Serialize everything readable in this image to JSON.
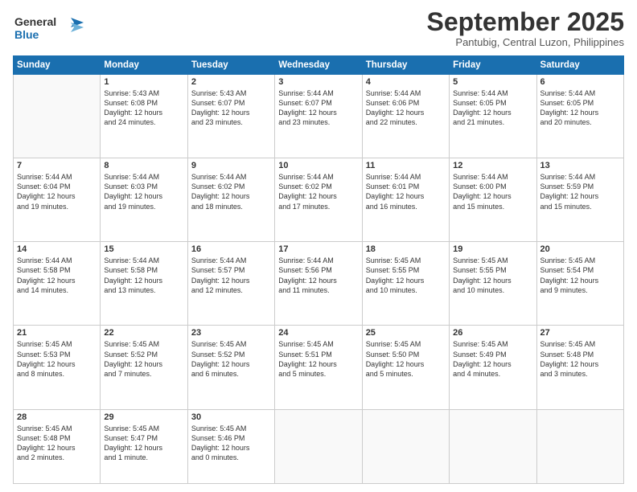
{
  "logo": {
    "line1": "General",
    "line2": "Blue"
  },
  "title": "September 2025",
  "location": "Pantubig, Central Luzon, Philippines",
  "days_header": [
    "Sunday",
    "Monday",
    "Tuesday",
    "Wednesday",
    "Thursday",
    "Friday",
    "Saturday"
  ],
  "weeks": [
    [
      {
        "day": "",
        "text": ""
      },
      {
        "day": "1",
        "text": "Sunrise: 5:43 AM\nSunset: 6:08 PM\nDaylight: 12 hours\nand 24 minutes."
      },
      {
        "day": "2",
        "text": "Sunrise: 5:43 AM\nSunset: 6:07 PM\nDaylight: 12 hours\nand 23 minutes."
      },
      {
        "day": "3",
        "text": "Sunrise: 5:44 AM\nSunset: 6:07 PM\nDaylight: 12 hours\nand 23 minutes."
      },
      {
        "day": "4",
        "text": "Sunrise: 5:44 AM\nSunset: 6:06 PM\nDaylight: 12 hours\nand 22 minutes."
      },
      {
        "day": "5",
        "text": "Sunrise: 5:44 AM\nSunset: 6:05 PM\nDaylight: 12 hours\nand 21 minutes."
      },
      {
        "day": "6",
        "text": "Sunrise: 5:44 AM\nSunset: 6:05 PM\nDaylight: 12 hours\nand 20 minutes."
      }
    ],
    [
      {
        "day": "7",
        "text": "Sunrise: 5:44 AM\nSunset: 6:04 PM\nDaylight: 12 hours\nand 19 minutes."
      },
      {
        "day": "8",
        "text": "Sunrise: 5:44 AM\nSunset: 6:03 PM\nDaylight: 12 hours\nand 19 minutes."
      },
      {
        "day": "9",
        "text": "Sunrise: 5:44 AM\nSunset: 6:02 PM\nDaylight: 12 hours\nand 18 minutes."
      },
      {
        "day": "10",
        "text": "Sunrise: 5:44 AM\nSunset: 6:02 PM\nDaylight: 12 hours\nand 17 minutes."
      },
      {
        "day": "11",
        "text": "Sunrise: 5:44 AM\nSunset: 6:01 PM\nDaylight: 12 hours\nand 16 minutes."
      },
      {
        "day": "12",
        "text": "Sunrise: 5:44 AM\nSunset: 6:00 PM\nDaylight: 12 hours\nand 15 minutes."
      },
      {
        "day": "13",
        "text": "Sunrise: 5:44 AM\nSunset: 5:59 PM\nDaylight: 12 hours\nand 15 minutes."
      }
    ],
    [
      {
        "day": "14",
        "text": "Sunrise: 5:44 AM\nSunset: 5:58 PM\nDaylight: 12 hours\nand 14 minutes."
      },
      {
        "day": "15",
        "text": "Sunrise: 5:44 AM\nSunset: 5:58 PM\nDaylight: 12 hours\nand 13 minutes."
      },
      {
        "day": "16",
        "text": "Sunrise: 5:44 AM\nSunset: 5:57 PM\nDaylight: 12 hours\nand 12 minutes."
      },
      {
        "day": "17",
        "text": "Sunrise: 5:44 AM\nSunset: 5:56 PM\nDaylight: 12 hours\nand 11 minutes."
      },
      {
        "day": "18",
        "text": "Sunrise: 5:45 AM\nSunset: 5:55 PM\nDaylight: 12 hours\nand 10 minutes."
      },
      {
        "day": "19",
        "text": "Sunrise: 5:45 AM\nSunset: 5:55 PM\nDaylight: 12 hours\nand 10 minutes."
      },
      {
        "day": "20",
        "text": "Sunrise: 5:45 AM\nSunset: 5:54 PM\nDaylight: 12 hours\nand 9 minutes."
      }
    ],
    [
      {
        "day": "21",
        "text": "Sunrise: 5:45 AM\nSunset: 5:53 PM\nDaylight: 12 hours\nand 8 minutes."
      },
      {
        "day": "22",
        "text": "Sunrise: 5:45 AM\nSunset: 5:52 PM\nDaylight: 12 hours\nand 7 minutes."
      },
      {
        "day": "23",
        "text": "Sunrise: 5:45 AM\nSunset: 5:52 PM\nDaylight: 12 hours\nand 6 minutes."
      },
      {
        "day": "24",
        "text": "Sunrise: 5:45 AM\nSunset: 5:51 PM\nDaylight: 12 hours\nand 5 minutes."
      },
      {
        "day": "25",
        "text": "Sunrise: 5:45 AM\nSunset: 5:50 PM\nDaylight: 12 hours\nand 5 minutes."
      },
      {
        "day": "26",
        "text": "Sunrise: 5:45 AM\nSunset: 5:49 PM\nDaylight: 12 hours\nand 4 minutes."
      },
      {
        "day": "27",
        "text": "Sunrise: 5:45 AM\nSunset: 5:48 PM\nDaylight: 12 hours\nand 3 minutes."
      }
    ],
    [
      {
        "day": "28",
        "text": "Sunrise: 5:45 AM\nSunset: 5:48 PM\nDaylight: 12 hours\nand 2 minutes."
      },
      {
        "day": "29",
        "text": "Sunrise: 5:45 AM\nSunset: 5:47 PM\nDaylight: 12 hours\nand 1 minute."
      },
      {
        "day": "30",
        "text": "Sunrise: 5:45 AM\nSunset: 5:46 PM\nDaylight: 12 hours\nand 0 minutes."
      },
      {
        "day": "",
        "text": ""
      },
      {
        "day": "",
        "text": ""
      },
      {
        "day": "",
        "text": ""
      },
      {
        "day": "",
        "text": ""
      }
    ]
  ]
}
